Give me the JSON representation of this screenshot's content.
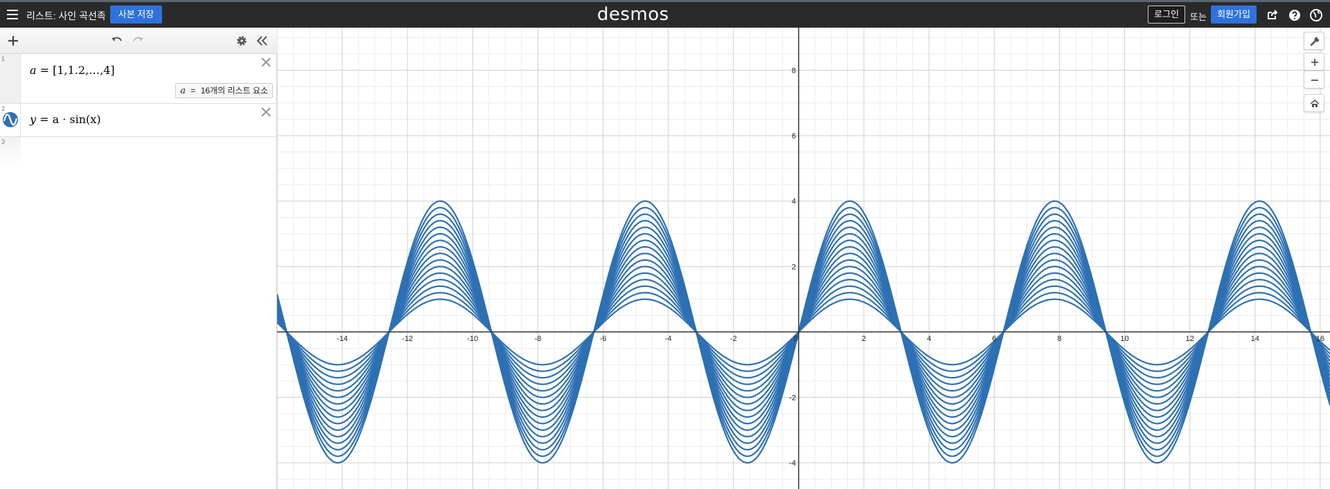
{
  "header": {
    "title": "리스트: 사인 곡선족",
    "save_copy_label": "사본 저장",
    "logo_text": "desmos",
    "login_label": "로그인",
    "or_text": "또는",
    "signup_label": "회원가입"
  },
  "expressions": [
    {
      "number": "1",
      "latex_lhs": "a",
      "latex_rhs": "[1,1.2,…,4]",
      "eval_var": "a",
      "eval_eq": "=",
      "eval_text": "16개의 리스트 요소"
    },
    {
      "number": "2",
      "latex_lhs": "y",
      "latex_rhs": "a · sin(x)"
    },
    {
      "number": "3"
    }
  ],
  "colors": {
    "curve": "#2d70b3",
    "header_bg": "#2a2a2a",
    "button_blue": "#2f72dc"
  },
  "icons": [
    "menu-icon",
    "share-icon",
    "help-icon",
    "globe-icon",
    "add-icon",
    "undo-icon",
    "redo-icon",
    "gear-icon",
    "collapse-icon",
    "close-icon",
    "sine-wave-icon",
    "wrench-icon",
    "zoom-in-icon",
    "zoom-out-icon",
    "home-icon"
  ],
  "chart_data": {
    "type": "line",
    "function": "y = a * sin(x)",
    "a_values": [
      1,
      1.2,
      1.4,
      1.6,
      1.8,
      2,
      2.2,
      2.4,
      2.6,
      2.8,
      3,
      3.2,
      3.4,
      3.6,
      3.8,
      4
    ],
    "xlim": [
      -16,
      16.3
    ],
    "ylim": [
      -4.8,
      9.3
    ],
    "x_ticks": [
      -14,
      -12,
      -10,
      -8,
      -6,
      -4,
      -2,
      2,
      4,
      6,
      8,
      10,
      12,
      14,
      16
    ],
    "y_ticks": [
      -4,
      -2,
      2,
      4,
      6,
      8
    ],
    "grid": true
  }
}
